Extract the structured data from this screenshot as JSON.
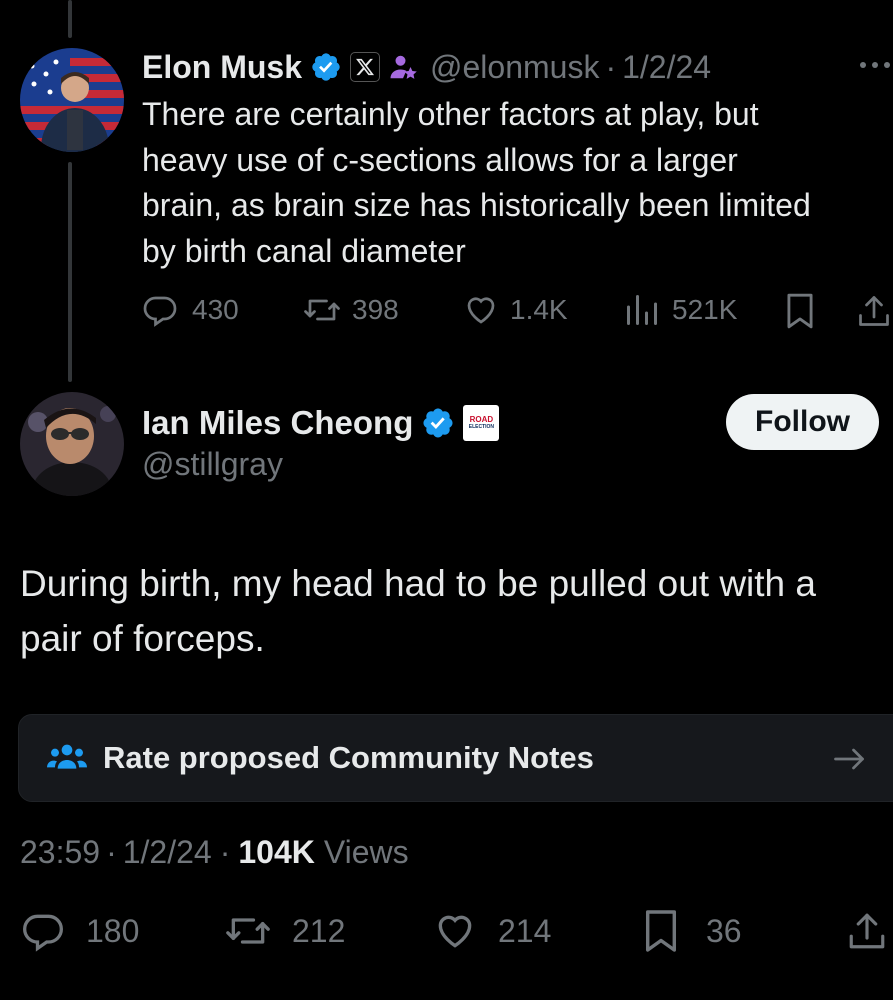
{
  "parent_tweet": {
    "author_name": "Elon Musk",
    "handle": "@elonmusk",
    "separator": "·",
    "date": "1/2/24",
    "more_icon": "more-horizontal-icon",
    "lines": [
      "There are certainly other factors at play, but",
      "heavy use of c-sections allows for a larger",
      "brain, as brain size has historically been limited",
      "by birth canal diameter"
    ],
    "replies": "430",
    "reposts": "398",
    "likes": "1.4K",
    "views": "521K"
  },
  "main_tweet": {
    "author_name": "Ian Miles Cheong",
    "handle": "@stillgray",
    "follow_label": "Follow",
    "affiliate_badge_text_1": "ROAD",
    "affiliate_badge_text_2": "ELECTION",
    "text_lines": [
      "During birth, my head had to be pulled out with a",
      "pair of forceps."
    ],
    "community_notes_label": "Rate proposed Community Notes",
    "time": "23:59",
    "sep1": "·",
    "date": "1/2/24",
    "sep2": "·",
    "views_count": "104K",
    "views_label": "Views",
    "replies": "180",
    "reposts": "212",
    "likes": "214",
    "bookmarks": "36"
  },
  "colors": {
    "background": "#000000",
    "text": "#e7e9ea",
    "muted": "#71767b",
    "verified": "#1d9bf0",
    "card": "#16181c",
    "follow_bg": "#eff3f4"
  }
}
